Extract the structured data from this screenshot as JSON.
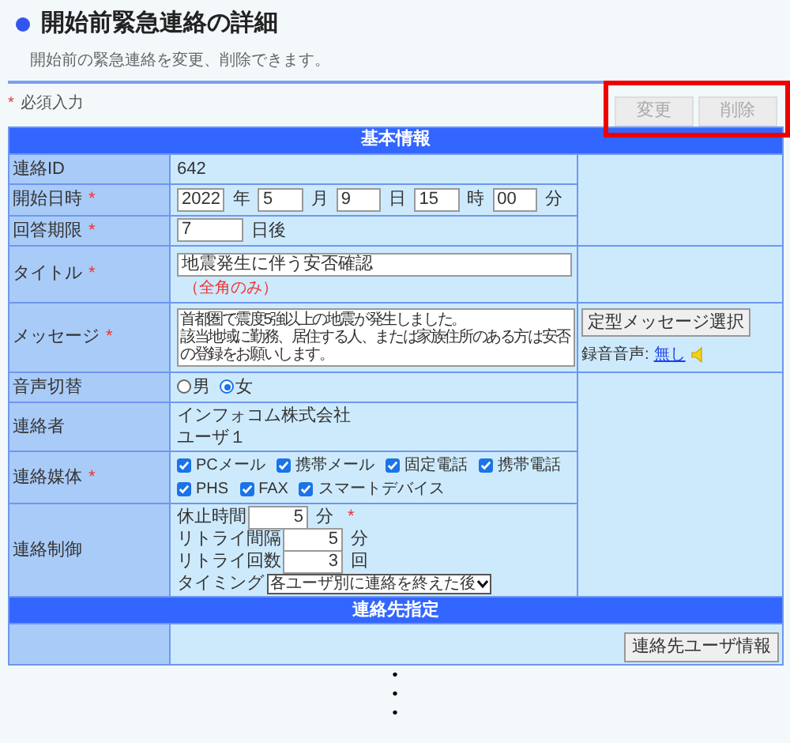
{
  "page": {
    "title": "開始前緊急連絡の詳細",
    "description": "開始前の緊急連絡を変更、削除できます。"
  },
  "required_note": {
    "mark": "*",
    "text": "必須入力"
  },
  "actions": {
    "highlighted": true,
    "buttons": [
      {
        "label": "変更",
        "disabled": true
      },
      {
        "label": "削除",
        "disabled": true
      }
    ]
  },
  "sections": [
    {
      "title": "基本情報",
      "rows": [
        {
          "kind": "text",
          "label": "連絡ID",
          "value": "642"
        },
        {
          "kind": "datetime",
          "label": "開始日時",
          "required": true,
          "parts": [
            {
              "value": "2022",
              "unit": "年"
            },
            {
              "value": "5",
              "unit": "月"
            },
            {
              "value": "9",
              "unit": "日"
            },
            {
              "value": "15",
              "unit": "時"
            },
            {
              "value": "00",
              "unit": "分"
            }
          ]
        },
        {
          "kind": "days",
          "label": "回答期限",
          "required": true,
          "value": "7",
          "unit": "日後"
        },
        {
          "kind": "title",
          "label": "タイトル",
          "required": true,
          "value": "地震発生に伴う安否確認",
          "note": "（全角のみ）"
        },
        {
          "kind": "message",
          "label": "メッセージ",
          "required": true,
          "lines": [
            "首都圏で震度5強以上の地震が発生しました。",
            "該当地域に勤務、居住する人、または家族住所のある方は安否",
            "の登録をお願いします。"
          ],
          "side_button": "定型メッセージ選択",
          "recording_label": "録音音声:",
          "recording_link": "無し"
        },
        {
          "kind": "radio",
          "label": "音声切替",
          "options": [
            {
              "label": "男",
              "selected": false
            },
            {
              "label": "女",
              "selected": true
            }
          ]
        },
        {
          "kind": "lines",
          "label": "連絡者",
          "lines": [
            "インフォコム株式会社",
            "ユーザ１"
          ]
        },
        {
          "kind": "checkboxes",
          "label": "連絡媒体",
          "required": true,
          "options": [
            {
              "label": "PCメール",
              "checked": true
            },
            {
              "label": "携帯メール",
              "checked": true
            },
            {
              "label": "固定電話",
              "checked": true
            },
            {
              "label": "携帯電話",
              "checked": true
            },
            {
              "label": "PHS",
              "checked": true
            },
            {
              "label": "FAX",
              "checked": true
            },
            {
              "label": "スマートデバイス",
              "checked": true
            }
          ]
        },
        {
          "kind": "control",
          "label": "連絡制御",
          "fields": [
            {
              "label": "休止時間",
              "value": "5",
              "unit": "分",
              "required": true
            },
            {
              "label": "リトライ間隔",
              "value": "5",
              "unit": "分"
            },
            {
              "label": "リトライ回数",
              "value": "3",
              "unit": "回"
            }
          ],
          "timing": {
            "label": "タイミング",
            "value": "各ユーザ別に連絡を終えた後"
          }
        }
      ]
    },
    {
      "title": "連絡先指定",
      "rows": [
        {
          "kind": "button",
          "button": "連絡先ユーザ情報"
        }
      ]
    }
  ],
  "more_marks": [
    "•",
    "•",
    "•"
  ]
}
